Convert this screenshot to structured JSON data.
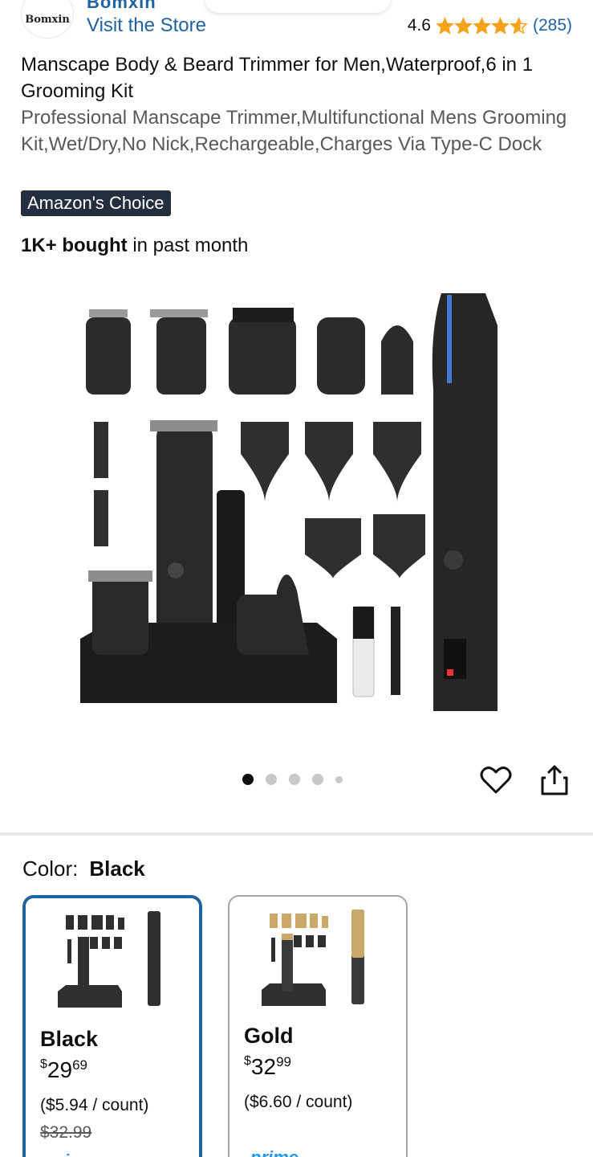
{
  "store": {
    "logo_text": "Bomxin",
    "name": "Bomxin",
    "visit_label": "Visit the Store"
  },
  "rating": {
    "score": "4.6",
    "stars": 4.6,
    "count": "(285)",
    "star_color": "#f7a21b"
  },
  "product": {
    "title": "Manscape Body & Beard Trimmer for Men,Waterproof,6 in 1 Grooming Kit",
    "subtitle": "Professional Manscape Trimmer,Multifunctional Mens Grooming Kit,Wet/Dry,No Nick,Rechargeable,Charges Via Type-C Dock",
    "badge": "Amazon's Choice",
    "bought_bold": "1K+ bought",
    "bought_rest": " in past month",
    "image_icon": "trimmer-kit-image"
  },
  "gallery": {
    "total_dots": 5,
    "active_index": 0
  },
  "actions": {
    "favorite_icon": "heart-icon",
    "share_icon": "share-icon"
  },
  "color": {
    "label": "Color:",
    "selected": "Black",
    "options": [
      {
        "name": "Black",
        "currency": "$",
        "whole": "29",
        "cents": "69",
        "per_count": "($5.94 / count)",
        "list_price": "$32.99",
        "prime": "prime",
        "accent": "#2f2f2f"
      },
      {
        "name": "Gold",
        "currency": "$",
        "whole": "32",
        "cents": "99",
        "per_count": "($6.60 / count)",
        "prime": "prime",
        "accent": "#c9a86a"
      }
    ]
  }
}
